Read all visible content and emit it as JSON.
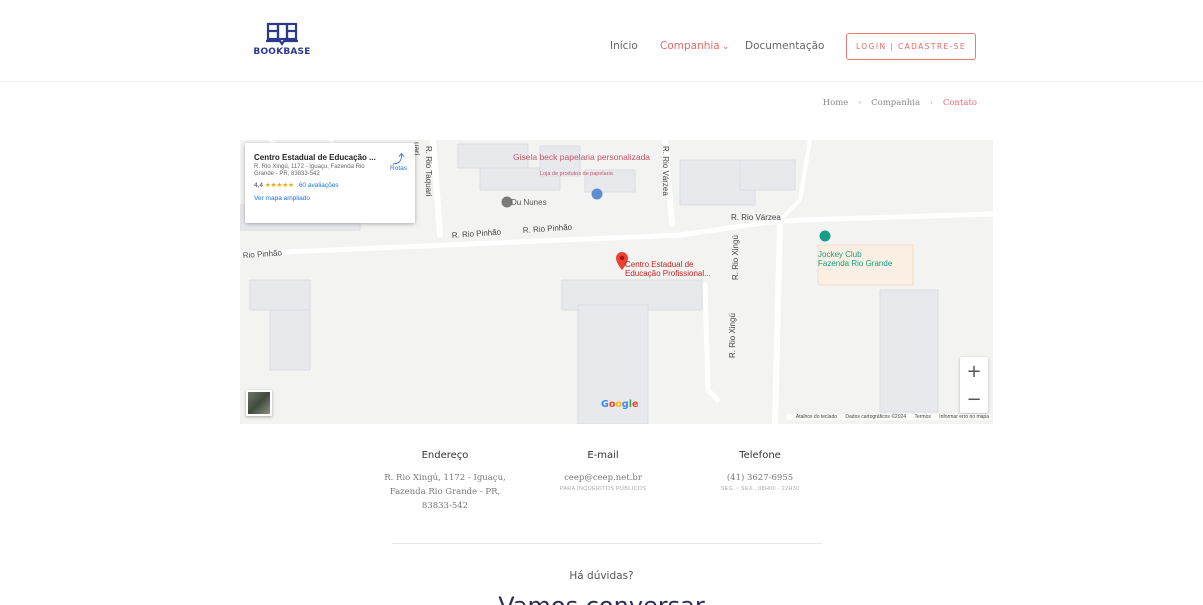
{
  "header": {
    "logo_text": "BOOKBASE",
    "nav": {
      "inicio": "Início",
      "companhia": "Companhia",
      "documentacao": "Documentação"
    },
    "login_label": "LOGIN | CADASTRE-SE"
  },
  "breadcrumb": {
    "home": "Home",
    "companhia": "Companhia",
    "current": "Contato"
  },
  "map": {
    "place_name": "Centro Estadual de Educação ...",
    "place_address": "R. Rio Xingú, 1172 - Iguaçu, Fazenda Rio Grande - PR, 83833-542",
    "rating": "4,4",
    "stars": "★★★★★",
    "reviews": "60 avaliações",
    "larger_map_link": "Ver mapa ampliado",
    "directions_label": "Rotas",
    "labels": {
      "gisela": "Gisela beck papelaria personalizada",
      "gisela_sub": "Loja de produtos de papelaria",
      "du_nunes": "Du Nunes",
      "rio_pinhao_1": "R. Rio Pinhão",
      "rio_pinhao_2": "R. Rio Pinhão",
      "rio_pinhao_3": "Rio Pinhão",
      "rio_varzea_h": "R. Rio Várzea",
      "rio_varzea_v": "R. Rio Várzea",
      "rio_taquari": "R. Rio Taquari",
      "rio_taquari_partial": "uari",
      "rio_xingu_1": "R. Rio Xingú",
      "rio_xingu_2": "R. Rio Xingú",
      "centro_line1": "Centro Estadual de",
      "centro_line2": "Educação Profissional...",
      "jockey_line1": "Jockey Club",
      "jockey_line2": "Fazenda Rio Grande"
    },
    "zoom_in": "+",
    "zoom_out": "−",
    "google_logo": "Google",
    "footer": {
      "shortcuts": "Atalhos do teclado",
      "data": "Dados cartográficos ©2024",
      "terms": "Termos",
      "report": "Informar erro no mapa"
    }
  },
  "contact": {
    "address": {
      "title": "Endereço",
      "line1": "R. Rio Xingú, 1172 - Iguaçu,",
      "line2": "Fazenda Rio Grande - PR,",
      "line3": "83833-542"
    },
    "email": {
      "title": "E-mail",
      "value": "ceep@ceep.net.br",
      "sub": "PARA INQUÉRITOS PÚBLICOS"
    },
    "phone": {
      "title": "Telefone",
      "value": "(41) 3627-6955",
      "sub": "SEG. - SEX., 08H00 - 22H30"
    }
  },
  "cta": {
    "question": "Há dúvidas?",
    "heading": "Vamos conversar"
  }
}
